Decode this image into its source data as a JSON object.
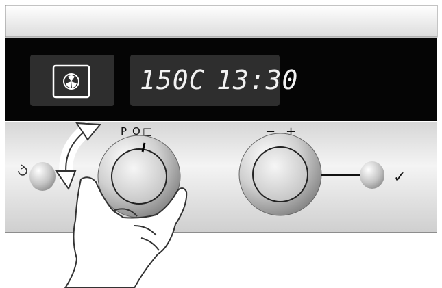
{
  "display": {
    "temperature": "150C",
    "time": "13:30",
    "mode_icon": "fan-icon"
  },
  "left_knob": {
    "labels": [
      "P",
      "O",
      "□"
    ],
    "rotate_icon": "rotate-arrows-icon"
  },
  "right_knob": {
    "minus": "−",
    "plus": "+"
  },
  "buttons": {
    "left_icon": "circular-arrow-icon",
    "right_icon": "checkmark-icon",
    "right_symbol": "✓",
    "left_symbol": "○"
  },
  "colors": {
    "display_strip": "#050505",
    "display_window": "#2e2e2e",
    "panel_top": "#e4e4e4",
    "panel_bottom": "#d0d0d0"
  }
}
